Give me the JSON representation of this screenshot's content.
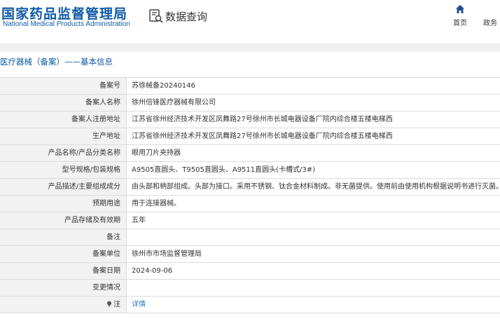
{
  "header": {
    "brand_cn": "国家药品监督管理局",
    "brand_en": "National Medical Products Administration",
    "query_title": "数据查询",
    "nav": [
      {
        "label": "首页",
        "icon": "home-icon"
      },
      {
        "label": "政务"
      }
    ]
  },
  "section_title": "医疗器械（备案）——基本信息",
  "rows": [
    {
      "label": "备案号",
      "value": "苏徐械备20240146"
    },
    {
      "label": "备案人名称",
      "value": "徐州倍锋医疗器械有限公司"
    },
    {
      "label": "备案人注册地址",
      "value": "江苏省徐州经济技术开发区凤舞路27号徐州市长城电器设备厂院内综合楼五楼电梯西"
    },
    {
      "label": "生产地址",
      "value": "江苏省徐州经济技术开发区凤舞路27号徐州市长城电器设备厂院内综合楼五楼电梯西"
    },
    {
      "label": "产品名称/产品分类名称",
      "value": "眼用刀片夹持器"
    },
    {
      "label": "型号规格/包装规格",
      "value": "A9505直圆头、T9505直圆头、A9511直圆头(卡槽式/3#)"
    },
    {
      "label": "产品描述/主要组成成分",
      "value": "由头部和柄部组成。头部为接口。采用不锈钢、钛合金材料制成。非无菌提供。使用前由使用机构根据说明书进行灭菌。"
    },
    {
      "label": "预期用途",
      "value": "用于连接器械。"
    },
    {
      "label": "产品存储及有效期",
      "value": "五年"
    },
    {
      "label": "备注",
      "value": ""
    },
    {
      "label": "备案单位",
      "value": "徐州市市场监督管理局"
    },
    {
      "label": "备案日期",
      "value": "2024-09-06"
    },
    {
      "label": "变更情况",
      "value": ""
    },
    {
      "label": "注",
      "value": "详情",
      "icon": "pin-icon"
    }
  ],
  "colors": {
    "brand": "#0f5ba6",
    "link": "#2f74c0",
    "label_bg": "#f2f2f2",
    "border": "#dcdcdc"
  }
}
